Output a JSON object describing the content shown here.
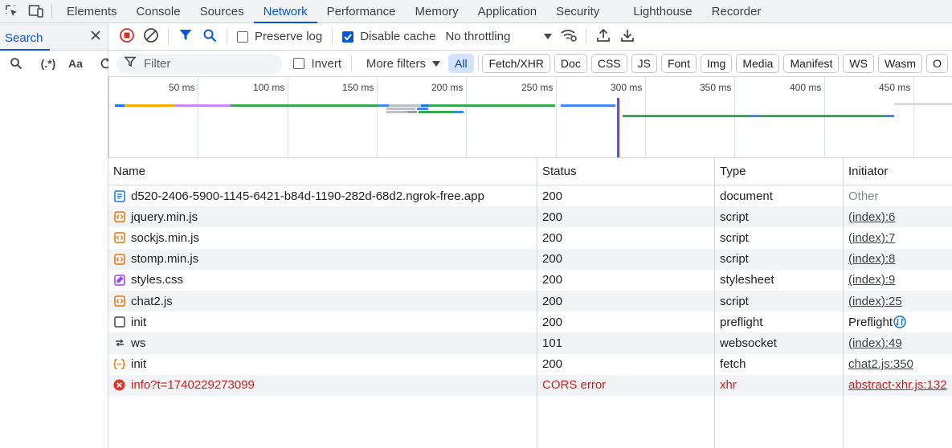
{
  "tabs": [
    "Elements",
    "Console",
    "Sources",
    "Network",
    "Performance",
    "Memory",
    "Application",
    "Security",
    "Lighthouse",
    "Recorder"
  ],
  "active_tab": "Network",
  "search_panel": {
    "title": "Search",
    "regex_label": "(.*)",
    "case_label": "Aa"
  },
  "toolbar": {
    "preserve_log": "Preserve log",
    "disable_cache": "Disable cache",
    "throttling": "No throttling"
  },
  "filter_bar": {
    "placeholder": "Filter",
    "invert": "Invert",
    "more_filters": "More filters",
    "chips": [
      "All",
      "Fetch/XHR",
      "Doc",
      "CSS",
      "JS",
      "Font",
      "Img",
      "Media",
      "Manifest",
      "WS",
      "Wasm",
      "O"
    ]
  },
  "overview": {
    "ticks": [
      "50 ms",
      "100 ms",
      "150 ms",
      "200 ms",
      "250 ms",
      "300 ms",
      "350 ms",
      "400 ms",
      "450 ms"
    ]
  },
  "table": {
    "headers": {
      "name": "Name",
      "status": "Status",
      "type": "Type",
      "initiator": "Initiator"
    },
    "rows": [
      {
        "name": "d520-2406-5900-1145-6421-b84d-1190-282d-68d2.ngrok-free.app",
        "status": "200",
        "type": "document",
        "initiator": "Other",
        "icon": "document-icon"
      },
      {
        "name": "jquery.min.js",
        "status": "200",
        "type": "script",
        "initiator": "(index):6",
        "icon": "script-icon"
      },
      {
        "name": "sockjs.min.js",
        "status": "200",
        "type": "script",
        "initiator": "(index):7",
        "icon": "script-icon"
      },
      {
        "name": "stomp.min.js",
        "status": "200",
        "type": "script",
        "initiator": "(index):8",
        "icon": "script-icon"
      },
      {
        "name": "styles.css",
        "status": "200",
        "type": "stylesheet",
        "initiator": "(index):9",
        "icon": "stylesheet-icon"
      },
      {
        "name": "chat2.js",
        "status": "200",
        "type": "script",
        "initiator": "(index):25",
        "icon": "script-icon"
      },
      {
        "name": "init",
        "status": "200",
        "type": "preflight",
        "initiator": "Preflight",
        "icon": "preflight-icon"
      },
      {
        "name": "ws",
        "status": "101",
        "type": "websocket",
        "initiator": "(index):49",
        "icon": "websocket-icon"
      },
      {
        "name": "init",
        "status": "200",
        "type": "fetch",
        "initiator": "chat2.js:350",
        "icon": "fetch-icon"
      },
      {
        "name": "info?t=1740229273099",
        "status": "CORS error",
        "type": "xhr",
        "initiator": "abstract-xhr.js:132",
        "icon": "error-icon"
      }
    ]
  }
}
